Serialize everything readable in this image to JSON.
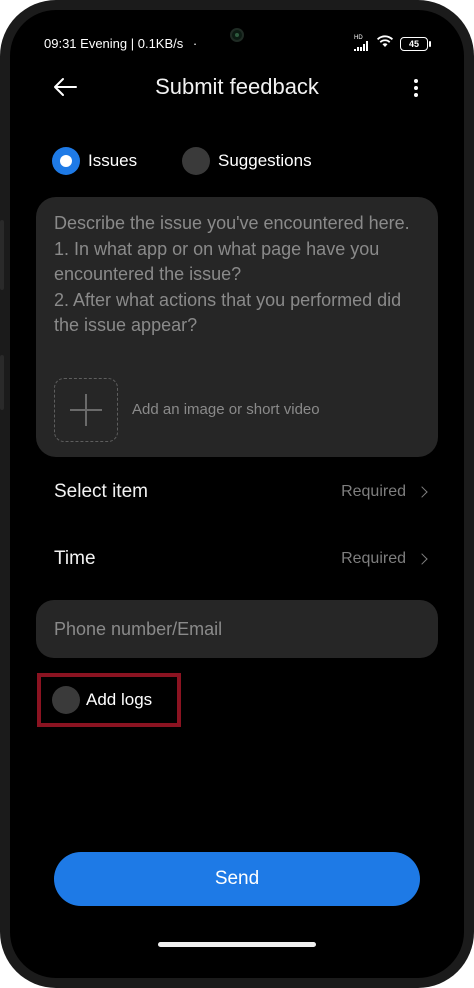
{
  "status_bar": {
    "time_text": "09:31 Evening | 0.1KB/s",
    "dot": "·",
    "network_label": "HD",
    "battery_level": "45"
  },
  "header": {
    "title": "Submit feedback",
    "back_icon": "arrow-left-icon",
    "more_icon": "more-vertical-icon"
  },
  "feedback_type": {
    "options": [
      {
        "label": "Issues",
        "selected": true
      },
      {
        "label": "Suggestions",
        "selected": false
      }
    ]
  },
  "description": {
    "placeholder": "Describe the issue you've encountered here.\n1. In what app or on what page have you encountered the issue?\n2. After what actions that you performed did the issue appear?",
    "add_media_label": "Add an image or short video"
  },
  "rows": {
    "select_item": {
      "label": "Select item",
      "value": "Required"
    },
    "time": {
      "label": "Time",
      "value": "Required"
    }
  },
  "contact": {
    "placeholder": "Phone number/Email"
  },
  "logs": {
    "label": "Add logs",
    "checked": false
  },
  "actions": {
    "send_label": "Send"
  },
  "colors": {
    "accent": "#1e7ae6",
    "highlight": "#8b1321",
    "surface": "#262626",
    "background": "#000000"
  }
}
